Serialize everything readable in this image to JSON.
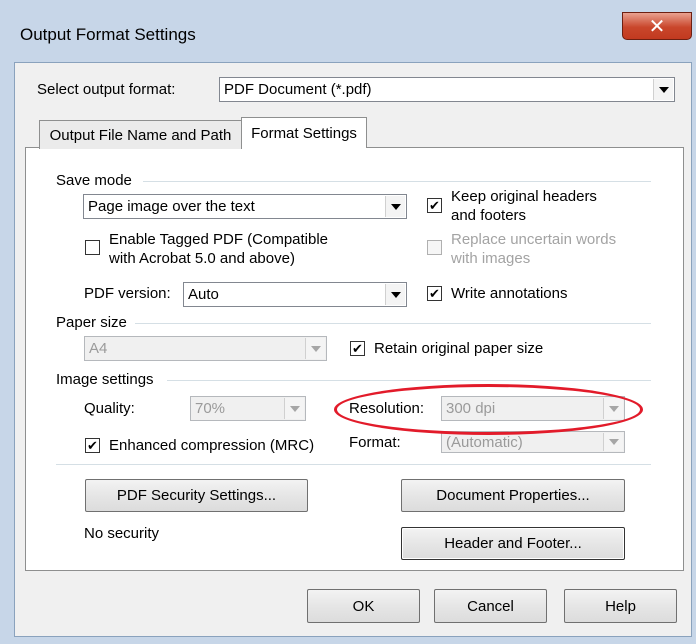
{
  "window": {
    "title": "Output Format Settings",
    "close_glyph": "✕"
  },
  "format": {
    "label": "Select output format:",
    "value": "PDF Document (*.pdf)"
  },
  "tabs": [
    {
      "label": "Output File Name and Path"
    },
    {
      "label": "Format Settings"
    }
  ],
  "save_mode": {
    "heading": "Save mode",
    "mode_value": "Page image over the text",
    "keep_headers": {
      "line1": "Keep original headers",
      "line2": "and footers",
      "checked": true
    },
    "tagged_pdf": {
      "line1": "Enable Tagged PDF (Compatible",
      "line2": "with Acrobat 5.0 and above)",
      "checked": false
    },
    "replace_words": {
      "line1": "Replace uncertain words",
      "line2": "with images",
      "checked": false
    },
    "pdf_version": {
      "label": "PDF version:",
      "value": "Auto"
    },
    "write_annotations": {
      "label": "Write annotations",
      "checked": true
    }
  },
  "paper": {
    "heading": "Paper size",
    "value": "A4",
    "retain": {
      "label": "Retain original paper size",
      "checked": true
    }
  },
  "image": {
    "heading": "Image settings",
    "quality": {
      "label": "Quality:",
      "value": "70%"
    },
    "resolution": {
      "label": "Resolution:",
      "value": "300 dpi"
    },
    "mrc": {
      "label": "Enhanced compression (MRC)",
      "checked": true
    },
    "format": {
      "label": "Format:",
      "value": "(Automatic)"
    }
  },
  "security": {
    "button": "PDF Security Settings...",
    "status": "No security"
  },
  "document_properties": "Document Properties...",
  "header_footer": "Header and Footer...",
  "footer": {
    "ok": "OK",
    "cancel": "Cancel",
    "help": "Help"
  },
  "check_glyph": "✔",
  "colors": {
    "annotation_ellipse": "#e21b2a",
    "title_bar": "#c7d6e8",
    "close_button": "#c9462b"
  }
}
